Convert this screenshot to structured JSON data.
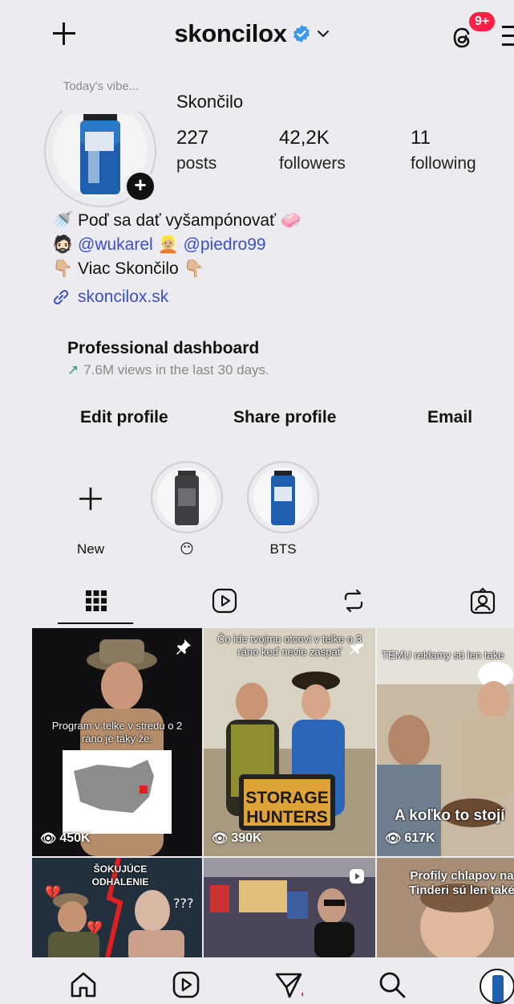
{
  "header": {
    "username": "skoncilox",
    "notification_badge": "9+"
  },
  "profile": {
    "note": "Today's vibe...",
    "display_name": "Skončilo",
    "stats": [
      {
        "value": "227",
        "label": "posts"
      },
      {
        "value": "42,2K",
        "label": "followers"
      },
      {
        "value": "11",
        "label": "following"
      }
    ],
    "bio": {
      "line1": "Poď sa dať vyšampónovať",
      "mention1": "@wukarel",
      "mention2": "@piedro99",
      "line3": "Viac Skončilo"
    },
    "link": "skoncilox.sk"
  },
  "dashboard": {
    "title": "Professional dashboard",
    "subtitle": "7.6M views in the last 30 days."
  },
  "actions": {
    "edit": "Edit profile",
    "share": "Share profile",
    "email": "Email"
  },
  "highlights": [
    {
      "label": "New"
    },
    {
      "label": "😶"
    },
    {
      "label": "BTS"
    }
  ],
  "posts": [
    {
      "caption": "Program v telke v stredu o 2 ráno je taký že:",
      "views": "450K"
    },
    {
      "caption": "Čo ide tvojmu otcovi v telke o 3 ráno keď nevie zaspať",
      "overlay": "STORAGE HUNTERS",
      "views": "390K"
    },
    {
      "caption": "TEMU reklamy sú len take",
      "overlay": "A koľko to stojí",
      "views": "617K"
    },
    {
      "caption": "ŠOKUJÚCE ODHALENIE"
    },
    {
      "caption": ""
    },
    {
      "caption": "Profily chlapov na Tinderi sú len také"
    }
  ],
  "colors": {
    "accent": "#3b4fcc",
    "badge": "#ff1f45",
    "verified": "#3897f0",
    "background": "#ececf0"
  }
}
